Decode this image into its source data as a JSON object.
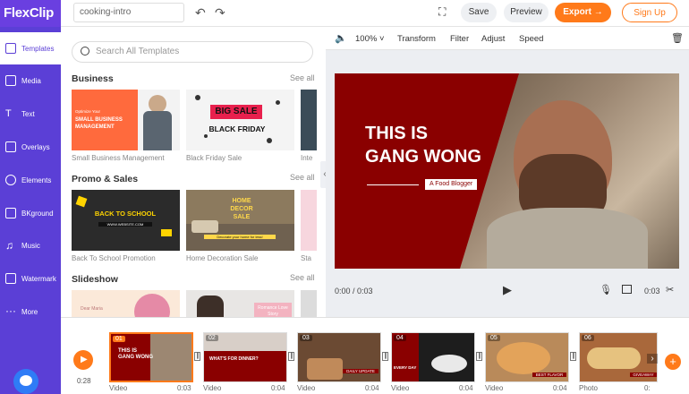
{
  "app": {
    "logo": "FlexClip",
    "project_name": "cooking-intro"
  },
  "topbar": {
    "save": "Save",
    "preview": "Preview",
    "export": "Export →",
    "signup": "Sign Up"
  },
  "nav": [
    {
      "label": "Templates",
      "icon": "templates-icon"
    },
    {
      "label": "Media",
      "icon": "media-icon"
    },
    {
      "label": "Text",
      "icon": "text-icon"
    },
    {
      "label": "Overlays",
      "icon": "overlays-icon"
    },
    {
      "label": "Elements",
      "icon": "elements-icon"
    },
    {
      "label": "BKground",
      "icon": "background-icon"
    },
    {
      "label": "Music",
      "icon": "music-icon"
    },
    {
      "label": "Watermark",
      "icon": "watermark-icon"
    },
    {
      "label": "More",
      "icon": "more-icon"
    }
  ],
  "panel": {
    "search_placeholder": "Search All Templates",
    "sections": [
      {
        "title": "Business",
        "see_all": "See all",
        "items": [
          {
            "label": "Small Business Management",
            "thumb_text": "SMALL BUSINESS MANAGEMENT",
            "thumb_small": "Optimize Your"
          },
          {
            "label": "Black Friday Sale",
            "thumb_text": "BIG SALE",
            "thumb_small": "BLACK FRIDAY"
          },
          {
            "label": "Inte"
          }
        ]
      },
      {
        "title": "Promo & Sales",
        "see_all": "See all",
        "items": [
          {
            "label": "Back To School Promotion",
            "thumb_text": "BACK TO SCHOOL",
            "thumb_small": "WWW.WEBSITE.COM"
          },
          {
            "label": "Home Decoration Sale",
            "thumb_text": "HOME DECOR SALE",
            "thumb_small": "Decorate your home for less!"
          },
          {
            "label": "Sta"
          }
        ]
      },
      {
        "title": "Slideshow",
        "see_all": "See all",
        "items": [
          {
            "label": "",
            "thumb_text": "Dear Maria"
          },
          {
            "label": "",
            "thumb_text": "Romance Love Story"
          }
        ]
      }
    ]
  },
  "editor": {
    "zoom": "100%",
    "tools": [
      "Transform",
      "Filter",
      "Adjust",
      "Speed"
    ],
    "headline_line1": "THIS IS",
    "headline_line2": "GANG WONG",
    "subtitle": "A Food Blogger",
    "current_time": "0:00 / 0:03",
    "duration": "0:03"
  },
  "timeline": {
    "total": "0:28",
    "clips": [
      {
        "num": "01",
        "type": "Video",
        "dur": "0:03",
        "text": "THIS IS GANG WONG"
      },
      {
        "num": "02",
        "type": "Video",
        "dur": "0:04",
        "text": "WHAT'S FOR DINNER?"
      },
      {
        "num": "03",
        "type": "Video",
        "dur": "0:04",
        "text": "DAILY UPDATE"
      },
      {
        "num": "04",
        "type": "Video",
        "dur": "0:04",
        "text": "EVERY DAY"
      },
      {
        "num": "05",
        "type": "Video",
        "dur": "0:04",
        "text": "BEST FLAVOR"
      },
      {
        "num": "06",
        "type": "Photo",
        "dur": "0:",
        "text": "GIVEAWAY"
      }
    ]
  },
  "colors": {
    "nav": "#5b3fd6",
    "accent": "#ff7a1a",
    "maroon": "#8a0000"
  }
}
